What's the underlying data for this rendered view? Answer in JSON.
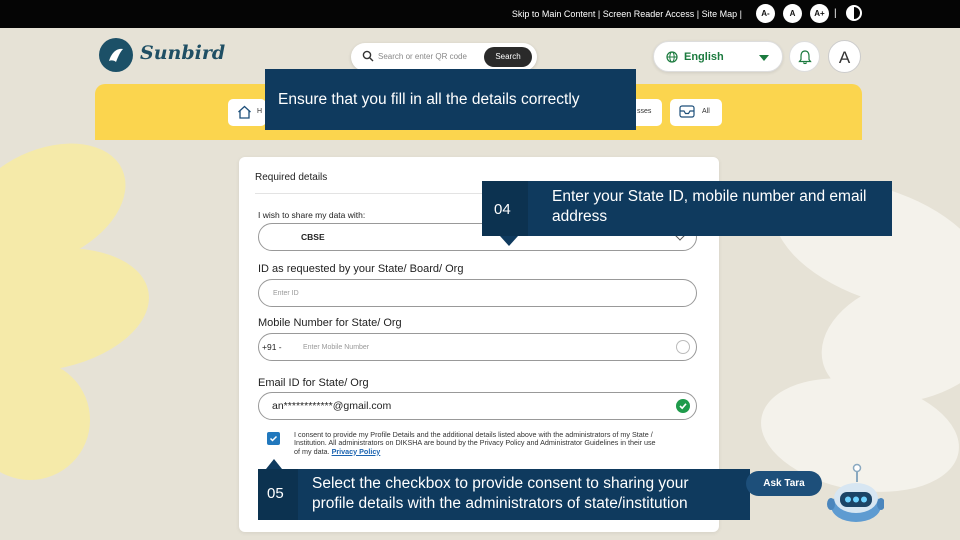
{
  "topbar": {
    "links_text": "Skip to Main Content | Screen Reader Access | Site Map |",
    "font_small": "A-",
    "font_normal": "A",
    "font_large": "A+",
    "separator": "|"
  },
  "header": {
    "logo_text": "Sunbird",
    "search_placeholder": "Search or enter QR code",
    "search_button": "Search",
    "language": "English",
    "avatar_initial": "A"
  },
  "nav": {
    "home_label": "H",
    "courses_label": "sses",
    "all_label": "All"
  },
  "form": {
    "title": "Required details",
    "share_label": "I wish to share my data with:",
    "share_value": "CBSE",
    "id_label": "ID as requested by your State/ Board/ Org",
    "id_placeholder": "Enter ID",
    "mobile_label": "Mobile Number for State/ Org",
    "mobile_prefix": "+91 -",
    "mobile_placeholder": "Enter Mobile Number",
    "email_label": "Email ID for State/ Org",
    "email_value": "an************@gmail.com",
    "consent_text": "I consent to provide my Profile Details and the additional details listed above with the administrators of my State / Institution. All administrators on DIKSHA are bound by the Privacy Policy and Administrator Guidelines in their use of my data.",
    "consent_link": "Privacy Policy",
    "consent_checked": true
  },
  "callouts": {
    "top": "Ensure that you fill in all the details correctly",
    "step4_num": "04",
    "step4_text": "Enter your State ID, mobile number and email address",
    "step5_num": "05",
    "step5_text_line1": "Select the checkbox to provide consent to sharing your",
    "step5_text_line2": "profile details with the administrators of state/institution"
  },
  "assistant": {
    "label": "Ask Tara"
  },
  "colors": {
    "callout": "#0f3a5e",
    "banner": "#fbd54e",
    "brand": "#1c5067",
    "language": "#1b7a3e",
    "valid": "#1f9b4b"
  }
}
